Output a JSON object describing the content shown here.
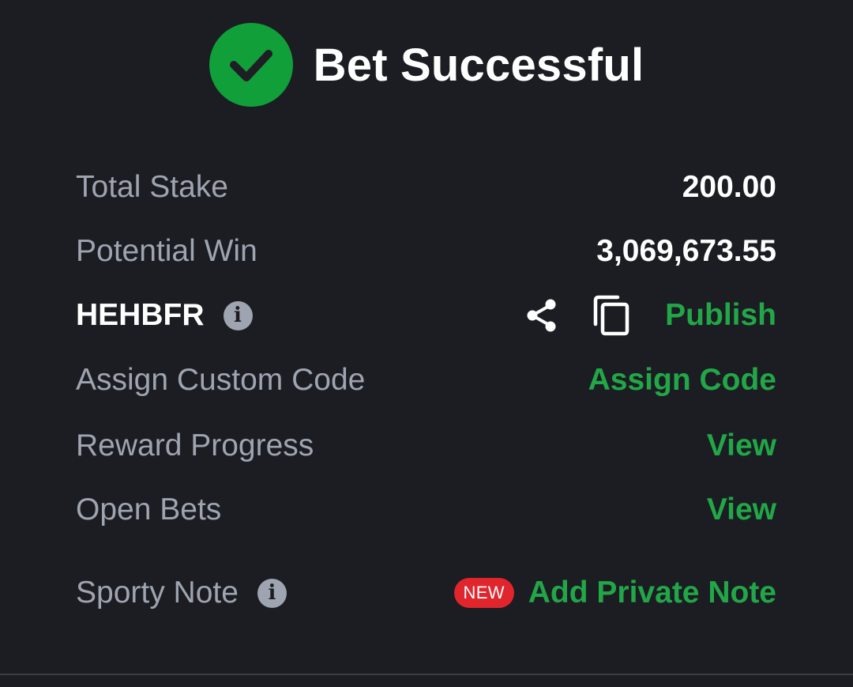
{
  "header": {
    "title": "Bet Successful"
  },
  "summary": {
    "total_stake_label": "Total Stake",
    "total_stake_value": "200.00",
    "potential_win_label": "Potential Win",
    "potential_win_value": "3,069,673.55"
  },
  "booking": {
    "code": "HEHBFR",
    "info_icon": "info-icon",
    "share_icon": "share-icon",
    "copy_icon": "copy-icon",
    "publish_label": "Publish"
  },
  "custom_code": {
    "label": "Assign Custom Code",
    "action_label": "Assign Code"
  },
  "reward_progress": {
    "label": "Reward Progress",
    "action_label": "View"
  },
  "open_bets": {
    "label": "Open Bets",
    "action_label": "View"
  },
  "sporty_note": {
    "label": "Sporty Note",
    "info_icon": "info-icon",
    "badge": "NEW",
    "action_label": "Add Private Note"
  },
  "colors": {
    "background": "#1b1d22",
    "accent_green": "#22a647",
    "success_circle": "#119f3a",
    "badge_red": "#e0252c",
    "muted_text": "#9ea4b0"
  }
}
